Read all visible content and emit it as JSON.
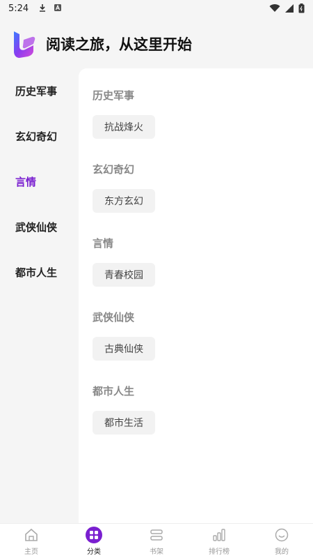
{
  "status_bar": {
    "time": "5:24"
  },
  "header": {
    "title": "阅读之旅，从这里开始"
  },
  "sidebar": {
    "items": [
      {
        "label": "历史军事"
      },
      {
        "label": "玄幻奇幻"
      },
      {
        "label": "言情"
      },
      {
        "label": "武侠仙侠"
      },
      {
        "label": "都市人生"
      }
    ],
    "active_index": 2
  },
  "content": {
    "sections": [
      {
        "title": "历史军事",
        "tag": "抗战烽火"
      },
      {
        "title": "玄幻奇幻",
        "tag": "东方玄幻"
      },
      {
        "title": "言情",
        "tag": "青春校园"
      },
      {
        "title": "武侠仙侠",
        "tag": "古典仙侠"
      },
      {
        "title": "都市人生",
        "tag": "都市生活"
      }
    ]
  },
  "tab_bar": {
    "tabs": [
      {
        "label": "主页",
        "icon": "home-icon"
      },
      {
        "label": "分类",
        "icon": "category-icon"
      },
      {
        "label": "书架",
        "icon": "bookshelf-icon"
      },
      {
        "label": "排行榜",
        "icon": "ranking-icon"
      },
      {
        "label": "我的",
        "icon": "profile-icon"
      }
    ],
    "active_index": 1
  },
  "colors": {
    "accent": "#7a1fd0",
    "background": "#f5f5f5",
    "panel": "#ffffff",
    "chip": "#f2f2f2"
  }
}
